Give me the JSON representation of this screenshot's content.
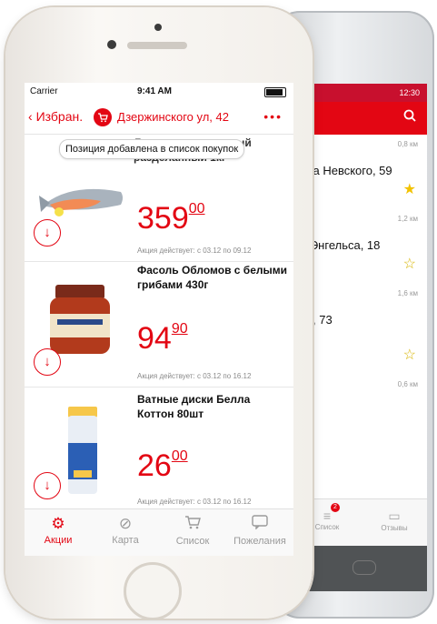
{
  "android": {
    "status_time": "12:30",
    "stores": [
      {
        "distance": "0,8 км",
        "address": "ира Невского, 59",
        "favorite": true
      },
      {
        "distance": "1,2 км",
        "address": "а Энгельса, 18",
        "favorite": false
      },
      {
        "distance": "1,6 км",
        "address": "ва, 73",
        "favorite": false
      },
      {
        "distance": "0,6 км",
        "address": "",
        "favorite": false
      }
    ],
    "tabs": [
      {
        "label": "Список",
        "icon": "list-icon",
        "badge": "2"
      },
      {
        "label": "Отзывы",
        "icon": "comment-icon"
      }
    ]
  },
  "ios": {
    "status": {
      "carrier": "Carrier",
      "time": "9:41 AM"
    },
    "nav": {
      "back_label": "Избран.",
      "store": "Дзержинского ул, 42",
      "more": "•••"
    },
    "toast": "Позиция добавлена в список покупок",
    "products": [
      {
        "name": "Лосось охлажденный разделанный 1кг",
        "price_int": "359",
        "price_frac": "00",
        "promo": "Акция действует: с 03.12 по 09.12"
      },
      {
        "name": "Фасоль Обломов с белыми грибами 430г",
        "price_int": "94",
        "price_frac": "90",
        "promo": "Акция действует: с 03.12 по 16.12"
      },
      {
        "name": "Ватные диски Белла Коттон 80шт",
        "price_int": "26",
        "price_frac": "00",
        "promo": "Акция действует: с 03.12 по 16.12"
      }
    ],
    "tabs": [
      {
        "label": "Акции",
        "icon": "percent-gear-icon",
        "active": true
      },
      {
        "label": "Карта",
        "icon": "compass-icon",
        "active": false
      },
      {
        "label": "Список",
        "icon": "cart-icon",
        "active": false
      },
      {
        "label": "Пожелания",
        "icon": "chat-icon",
        "active": false
      }
    ]
  },
  "colors": {
    "accent": "#e30613",
    "star": "#f2c200"
  }
}
